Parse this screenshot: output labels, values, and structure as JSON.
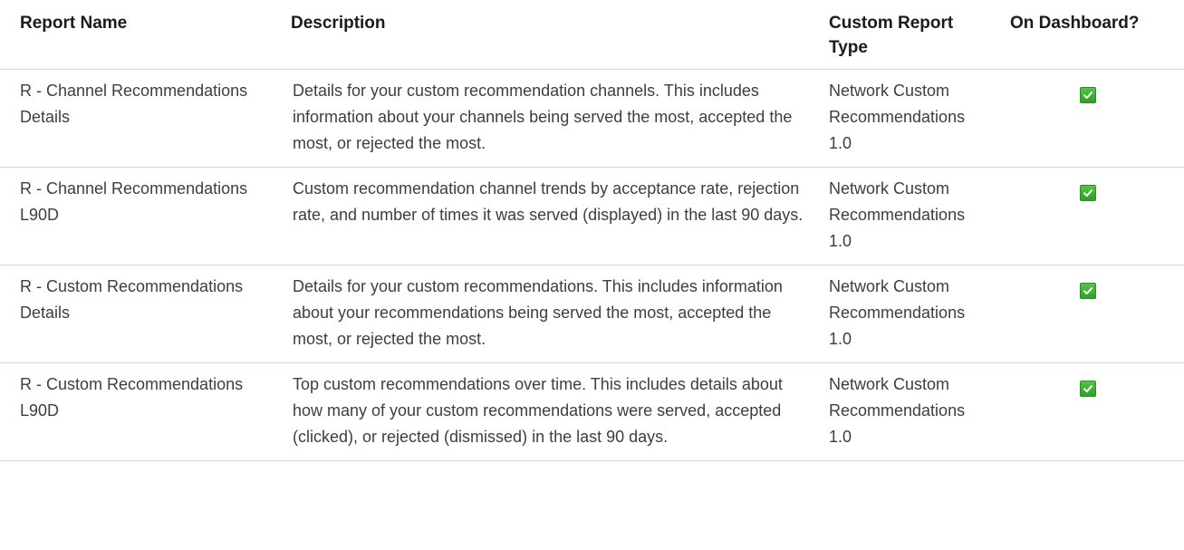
{
  "table": {
    "headers": {
      "report_name": "Report Name",
      "description": "Description",
      "custom_report_type": "Custom Report Type",
      "on_dashboard": "On Dashboard?"
    },
    "rows": [
      {
        "report_name": "R - Channel Recommendations Details",
        "description": "Details for your custom recommendation channels. This includes information about your channels being served the most, accepted the most, or rejected the most.",
        "custom_report_type": "Network Custom Recommendations 1.0",
        "on_dashboard": true
      },
      {
        "report_name": "R - Channel Recommendations L90D",
        "description": "Custom recommendation channel trends by acceptance rate, rejection rate, and number of times it was served (displayed) in the last 90 days.",
        "custom_report_type": "Network Custom Recommendations 1.0",
        "on_dashboard": true
      },
      {
        "report_name": "R - Custom Recommendations Details",
        "description": "Details for your custom recommendations. This includes information about your recommendations being served the most, accepted the most, or rejected the most.",
        "custom_report_type": "Network Custom Recommendations 1.0",
        "on_dashboard": true
      },
      {
        "report_name": "R - Custom Recommendations L90D",
        "description": "Top custom recommendations over time. This includes details about how many of your custom recommendations were served, accepted (clicked), or rejected (dismissed) in the last 90 days.",
        "custom_report_type": "Network Custom Recommendations 1.0",
        "on_dashboard": true
      }
    ],
    "check_icon": "checkmark-icon",
    "check_color": "#3ba935"
  }
}
